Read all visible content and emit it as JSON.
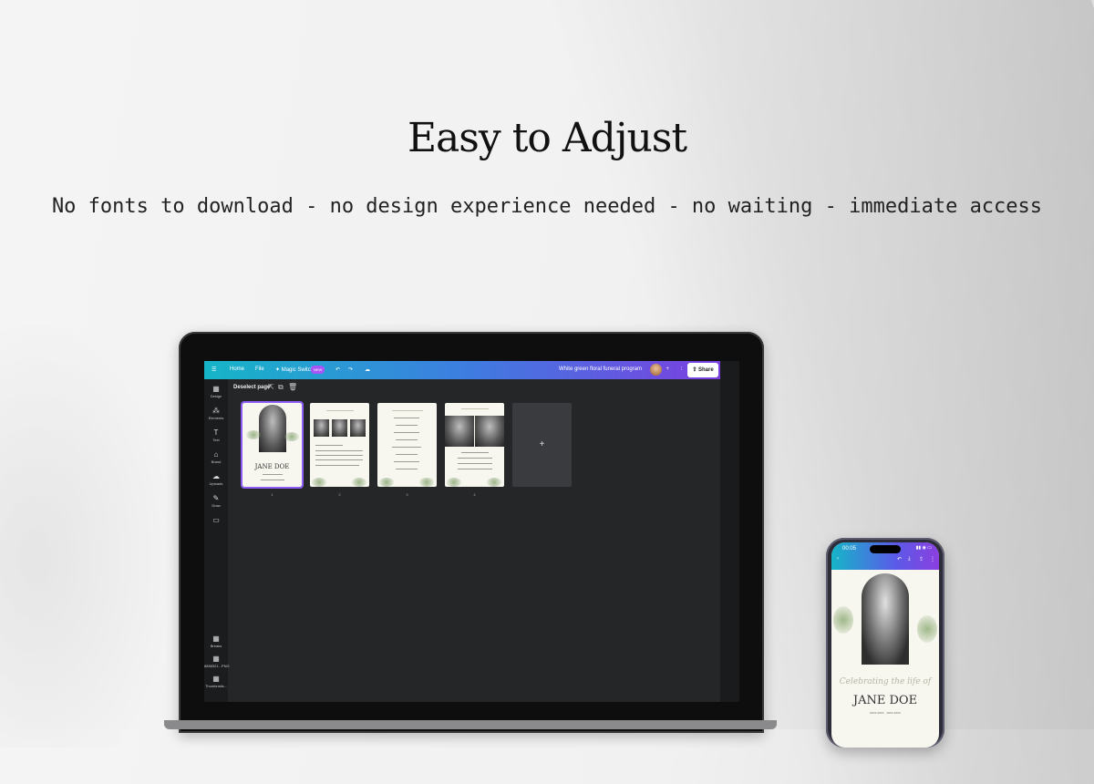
{
  "headline": "Easy to Adjust",
  "subline": "No fonts to download - no design experience needed - no waiting - immediate access",
  "editor": {
    "menu_icon": "☰",
    "home": "Home",
    "file": "File",
    "magic_switch": "✦ Magic Switch",
    "new_badge": "NEW",
    "undo_icon": "↶",
    "redo_icon": "↷",
    "cloud_icon": "☁",
    "doc_title": "White green floral funeral program",
    "plus_icon": "+",
    "stats_icon": "⫶",
    "share_label": "⇪ Share",
    "deselect_page": "Deselect page",
    "sidebar": [
      {
        "icon": "▦",
        "label": "Design"
      },
      {
        "icon": "⁂",
        "label": "Elements"
      },
      {
        "icon": "T",
        "label": "Text"
      },
      {
        "icon": "⌂",
        "label": "Brand"
      },
      {
        "icon": "☁",
        "label": "Uploads"
      },
      {
        "icon": "✎",
        "label": "Draw"
      },
      {
        "icon": "▭",
        "label": ""
      }
    ],
    "sidebar_bottom": [
      {
        "icon": "▦",
        "label": "Breaks"
      },
      {
        "icon": "▦",
        "label": "8858321...PNG"
      },
      {
        "icon": "▦",
        "label": "Thumbnails..."
      }
    ],
    "pages": [
      {
        "num": "1",
        "name": "JANE DOE"
      },
      {
        "num": "2"
      },
      {
        "num": "3"
      },
      {
        "num": "4"
      }
    ],
    "add_page": "+"
  },
  "phone": {
    "time": "00:05",
    "status_icons": "▮▮ ◉ ▭",
    "script": "Celebrating the life of",
    "name": "JANE DOE",
    "dates": "19XX-20XX · 19XX-20XX"
  },
  "colors": {
    "accent": "#8b5cf6",
    "bar_start": "#16b5c8",
    "bar_end": "#7b3fe0"
  }
}
